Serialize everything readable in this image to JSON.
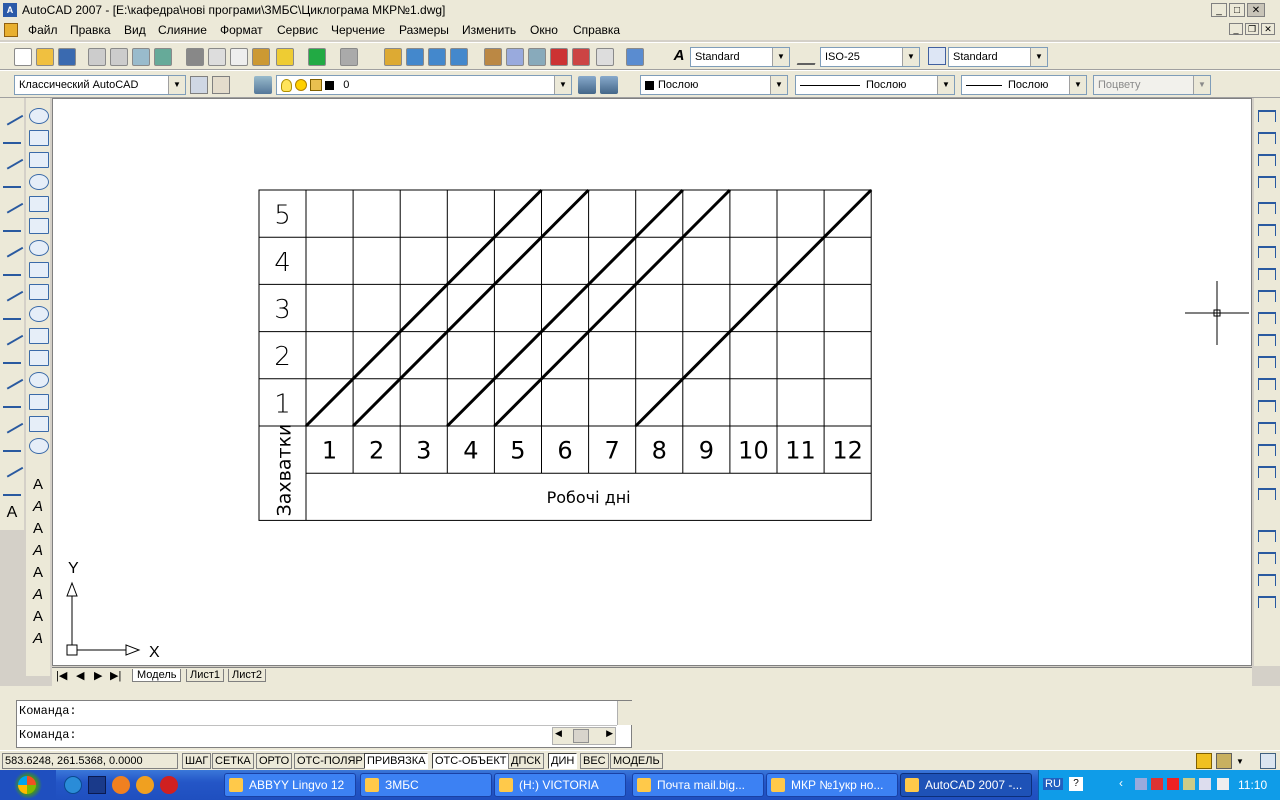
{
  "window": {
    "title": "AutoCAD 2007 - [E:\\кафедра\\нові програми\\ЗМБС\\Циклограма МКР№1.dwg]",
    "app_icon": "A",
    "controls": [
      "_",
      "□",
      "✕"
    ]
  },
  "menu": [
    "Файл",
    "Правка",
    "Вид",
    "Слияние",
    "Формат",
    "Сервис",
    "Черчение",
    "Размеры",
    "Изменить",
    "Окно",
    "Справка"
  ],
  "toolbar1": {
    "text_style": "Standard",
    "dim_style": "ISO-25",
    "table_style": "Standard"
  },
  "toolbar2": {
    "workspace": "Классический AutoCAD",
    "layer": "0",
    "color": "Послою",
    "linetype": "Послою",
    "lineweight": "Послою",
    "plotstyle": "Поцвету"
  },
  "drawing": {
    "row_labels": [
      "5",
      "4",
      "3",
      "2",
      "1"
    ],
    "col_labels": [
      "1",
      "2",
      "3",
      "4",
      "5",
      "6",
      "7",
      "8",
      "9",
      "10",
      "11",
      "12"
    ],
    "vertical_label": "Захватки",
    "horizontal_label": "Робочі дні",
    "ucs_x": "X",
    "ucs_y": "Y"
  },
  "tabs": [
    "Модель",
    "Лист1",
    "Лист2"
  ],
  "command": {
    "line1": "Команда:",
    "line2": "Команда:"
  },
  "status": {
    "coords": "583.6248, 261.5368, 0.0000",
    "buttons": [
      {
        "label": "ШАГ",
        "on": false
      },
      {
        "label": "СЕТКА",
        "on": false
      },
      {
        "label": "ОРТО",
        "on": false
      },
      {
        "label": "ОТС-ПОЛЯР",
        "on": false
      },
      {
        "label": "ПРИВЯЗКА",
        "on": true
      },
      {
        "label": "ОТС-ОБЪЕКТ",
        "on": true
      },
      {
        "label": "ДПСК",
        "on": false
      },
      {
        "label": "ДИН",
        "on": true
      },
      {
        "label": "ВЕС",
        "on": false
      },
      {
        "label": "МОДЕЛЬ",
        "on": false
      }
    ]
  },
  "taskbar": {
    "tasks": [
      "ABBYY Lingvo 12",
      "ЗМБС",
      "(H:) VICTORIA",
      "Почта mail.big...",
      "МКР №1укр но...",
      "AutoCAD 2007 -..."
    ],
    "lang": "RU",
    "clock": "11:10"
  }
}
